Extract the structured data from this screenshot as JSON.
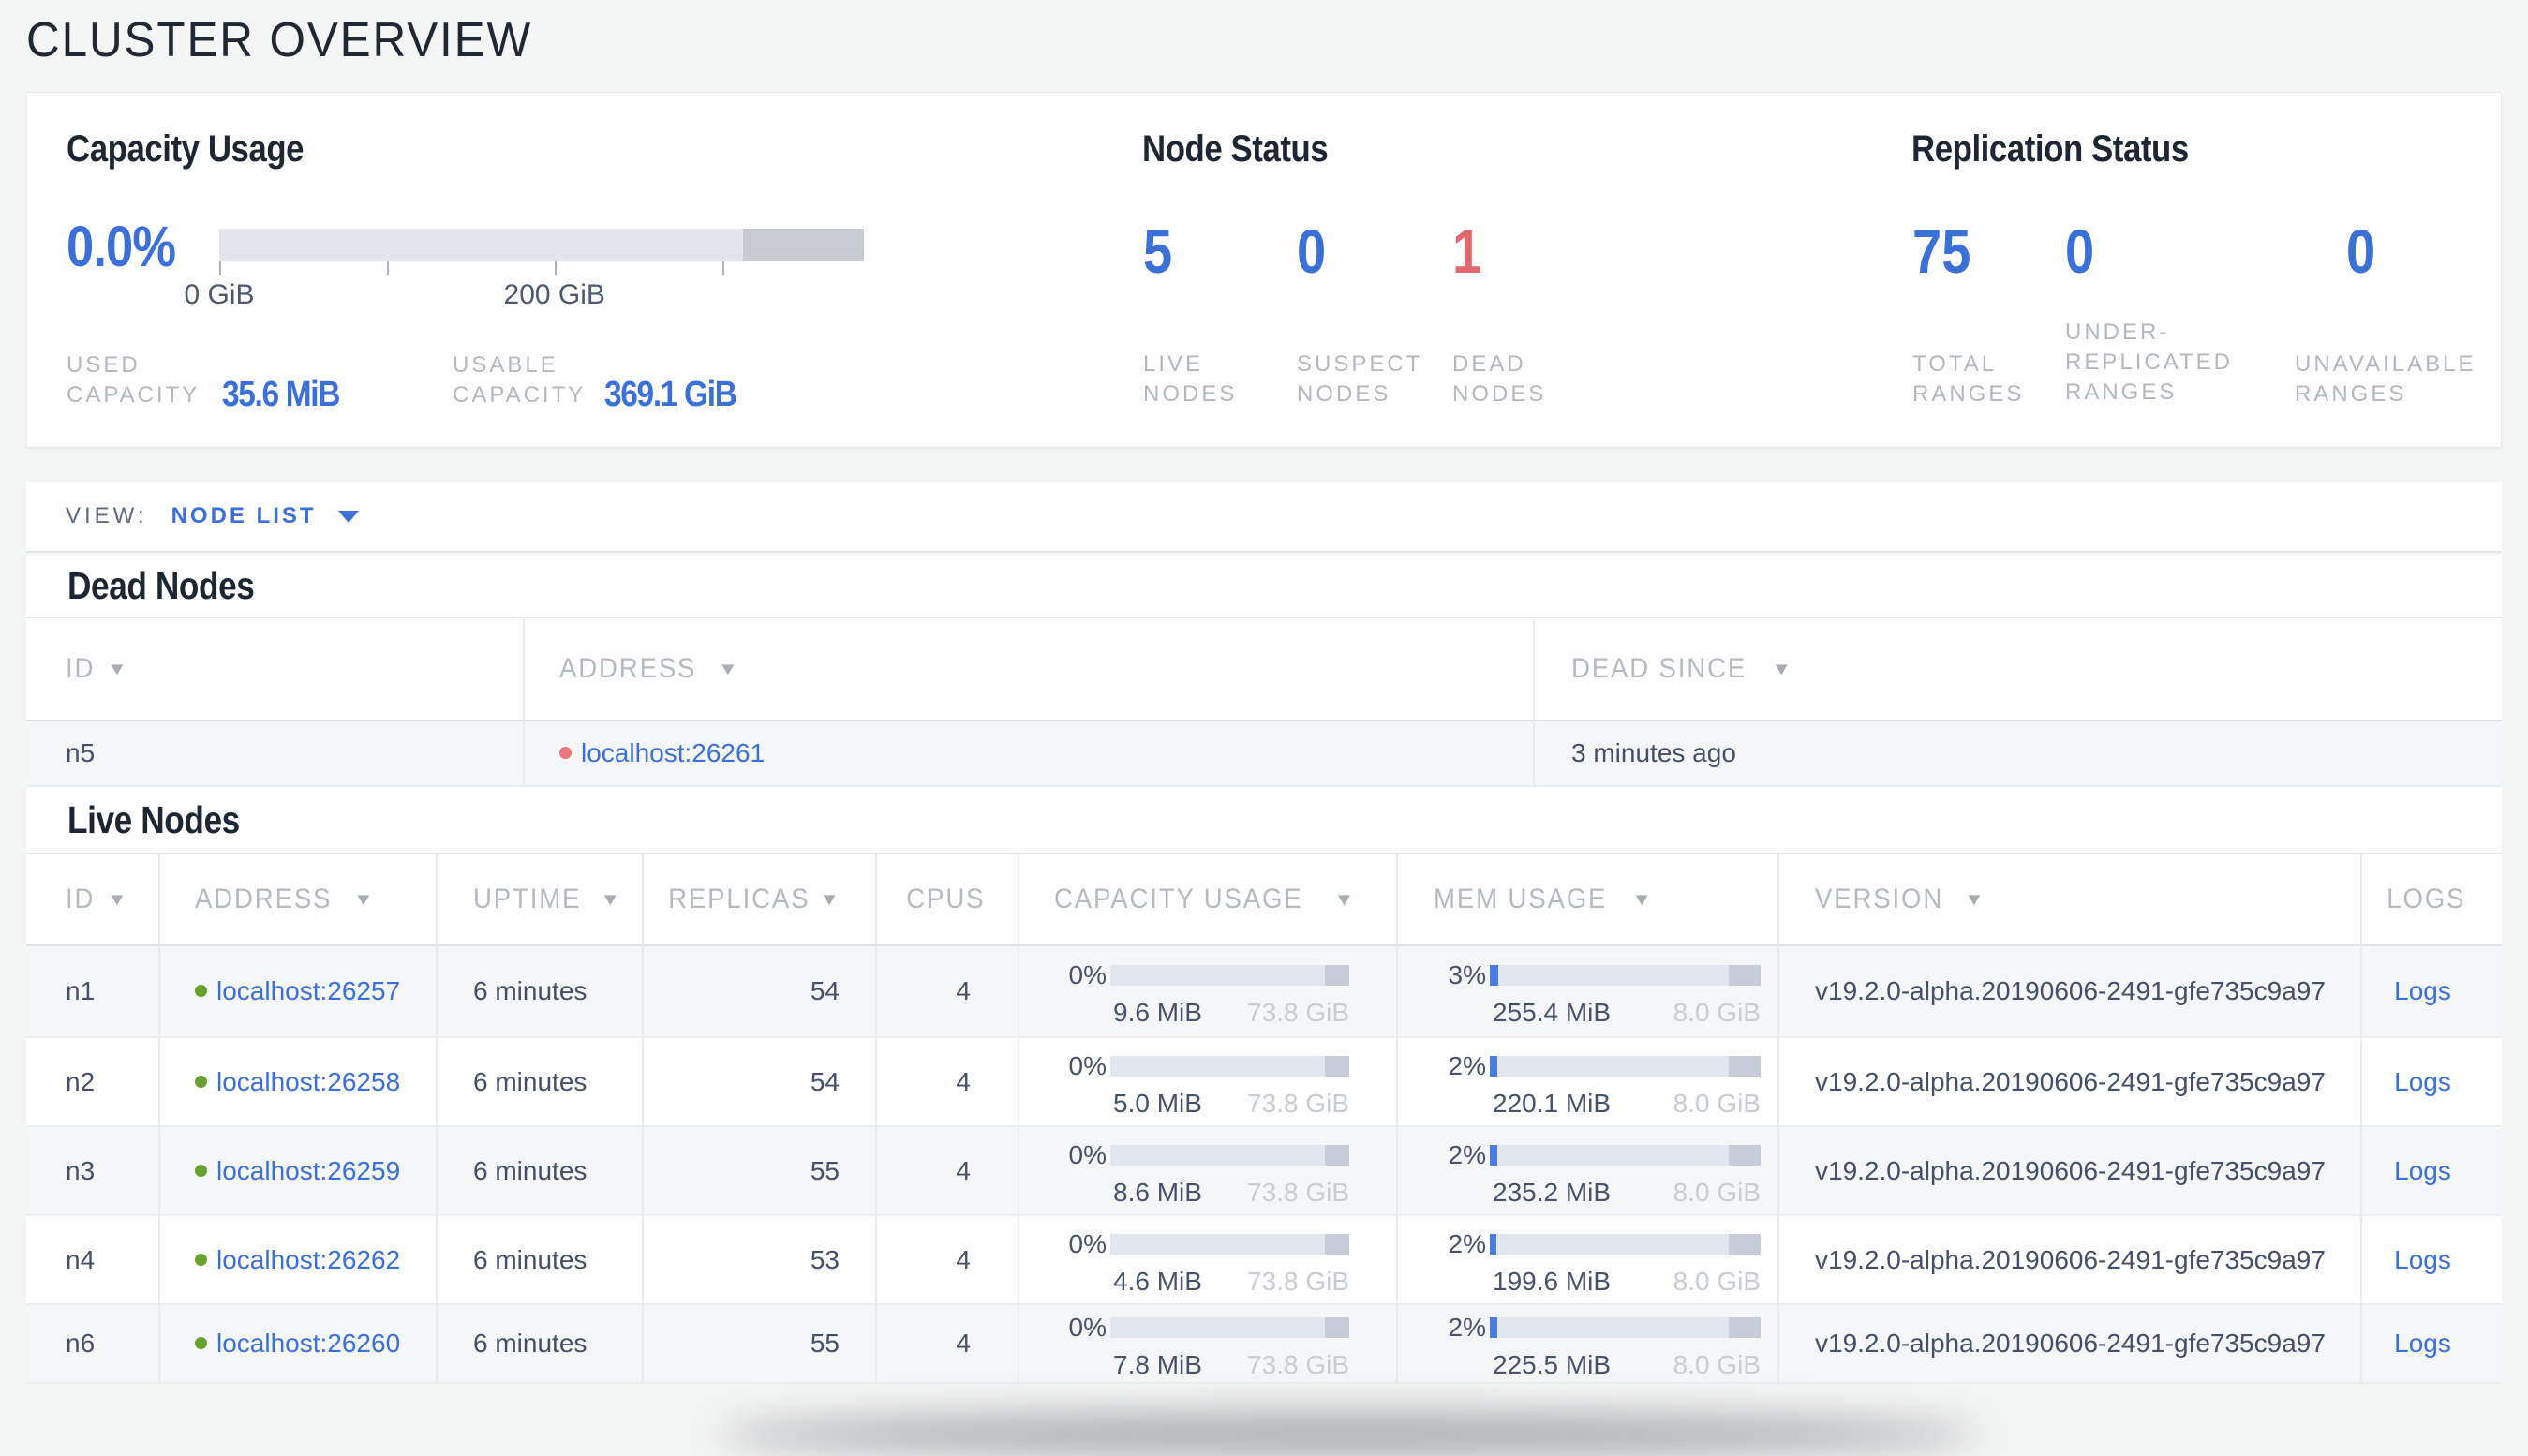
{
  "page": {
    "title": "CLUSTER OVERVIEW"
  },
  "icons": {
    "sort_desc": "▼"
  },
  "colors": {
    "accent_blue": "#3b70d6",
    "danger_red": "#e2686f",
    "live_green": "#65a32e",
    "bar_track": "#e2e6ee",
    "bar_dark": "#c8cdd9",
    "bar_used_blue": "#4a7de2"
  },
  "summary": {
    "capacity": {
      "title": "Capacity Usage",
      "percent": "0.0%",
      "chart": {
        "used_pct": 0,
        "dark_pct": 18.75,
        "ticks_pct": {
          "t0": 0,
          "t1": 26,
          "t2": 52,
          "t3": 78
        },
        "label0": {
          "text": "0 GiB",
          "pct": 0
        },
        "label1": {
          "text": "200 GiB",
          "pct": 52
        }
      },
      "used": {
        "label": "USED\nCAPACITY",
        "value": "35.6 MiB"
      },
      "usable": {
        "label": "USABLE\nCAPACITY",
        "value": "369.1 GiB"
      }
    },
    "node_status": {
      "title": "Node Status",
      "live": {
        "value": "5",
        "label": "LIVE\nNODES"
      },
      "suspect": {
        "value": "0",
        "label": "SUSPECT\nNODES"
      },
      "dead": {
        "value": "1",
        "label": "DEAD\nNODES"
      }
    },
    "replication": {
      "title": "Replication Status",
      "total": {
        "value": "75",
        "label": "TOTAL\nRANGES"
      },
      "under_replicated": {
        "value": "0",
        "label": "UNDER-\nREPLICATED\nRANGES"
      },
      "unavailable": {
        "value": "0",
        "label": "UNAVAILABLE\nRANGES"
      }
    }
  },
  "view_bar": {
    "label": "VIEW:",
    "selected": "NODE LIST"
  },
  "dead_nodes": {
    "title": "Dead Nodes",
    "columns": {
      "id": "ID",
      "address": "ADDRESS",
      "dead_since": "DEAD SINCE"
    },
    "rows": [
      {
        "id": "n5",
        "address": "localhost:26261",
        "dead_since": "3 minutes ago"
      }
    ]
  },
  "live_nodes": {
    "title": "Live Nodes",
    "columns": {
      "id": "ID",
      "address": "ADDRESS",
      "uptime": "UPTIME",
      "replicas": "REPLICAS",
      "cpus": "CPUS",
      "capacity": "CAPACITY USAGE",
      "memory": "MEM USAGE",
      "version": "VERSION",
      "logs": "LOGS"
    },
    "rows": [
      {
        "id": "n1",
        "address": "localhost:26257",
        "uptime": "6 minutes",
        "replicas": "54",
        "cpus": "4",
        "capacity": {
          "percent": "0%",
          "used": "9.6 MiB",
          "total": "73.8 GiB",
          "used_pct": 0,
          "dark_pct": 10.2
        },
        "memory": {
          "percent": "3%",
          "used": "255.4 MiB",
          "total": "8.0 GiB",
          "used_pct": 3.1,
          "dark_pct": 11.8
        },
        "version": "v19.2.0-alpha.20190606-2491-gfe735c9a97",
        "logs_label": "Logs"
      },
      {
        "id": "n2",
        "address": "localhost:26258",
        "uptime": "6 minutes",
        "replicas": "54",
        "cpus": "4",
        "capacity": {
          "percent": "0%",
          "used": "5.0 MiB",
          "total": "73.8 GiB",
          "used_pct": 0,
          "dark_pct": 10.2
        },
        "memory": {
          "percent": "2%",
          "used": "220.1 MiB",
          "total": "8.0 GiB",
          "used_pct": 2.7,
          "dark_pct": 11.8
        },
        "version": "v19.2.0-alpha.20190606-2491-gfe735c9a97",
        "logs_label": "Logs"
      },
      {
        "id": "n3",
        "address": "localhost:26259",
        "uptime": "6 minutes",
        "replicas": "55",
        "cpus": "4",
        "capacity": {
          "percent": "0%",
          "used": "8.6 MiB",
          "total": "73.8 GiB",
          "used_pct": 0,
          "dark_pct": 10.2
        },
        "memory": {
          "percent": "2%",
          "used": "235.2 MiB",
          "total": "8.0 GiB",
          "used_pct": 2.9,
          "dark_pct": 11.8
        },
        "version": "v19.2.0-alpha.20190606-2491-gfe735c9a97",
        "logs_label": "Logs"
      },
      {
        "id": "n4",
        "address": "localhost:26262",
        "uptime": "6 minutes",
        "replicas": "53",
        "cpus": "4",
        "capacity": {
          "percent": "0%",
          "used": "4.6 MiB",
          "total": "73.8 GiB",
          "used_pct": 0,
          "dark_pct": 10.2
        },
        "memory": {
          "percent": "2%",
          "used": "199.6 MiB",
          "total": "8.0 GiB",
          "used_pct": 2.4,
          "dark_pct": 11.8
        },
        "version": "v19.2.0-alpha.20190606-2491-gfe735c9a97",
        "logs_label": "Logs"
      },
      {
        "id": "n6",
        "address": "localhost:26260",
        "uptime": "6 minutes",
        "replicas": "55",
        "cpus": "4",
        "capacity": {
          "percent": "0%",
          "used": "7.8 MiB",
          "total": "73.8 GiB",
          "used_pct": 0,
          "dark_pct": 10.2
        },
        "memory": {
          "percent": "2%",
          "used": "225.5 MiB",
          "total": "8.0 GiB",
          "used_pct": 2.75,
          "dark_pct": 11.8
        },
        "version": "v19.2.0-alpha.20190606-2491-gfe735c9a97",
        "logs_label": "Logs"
      }
    ]
  }
}
